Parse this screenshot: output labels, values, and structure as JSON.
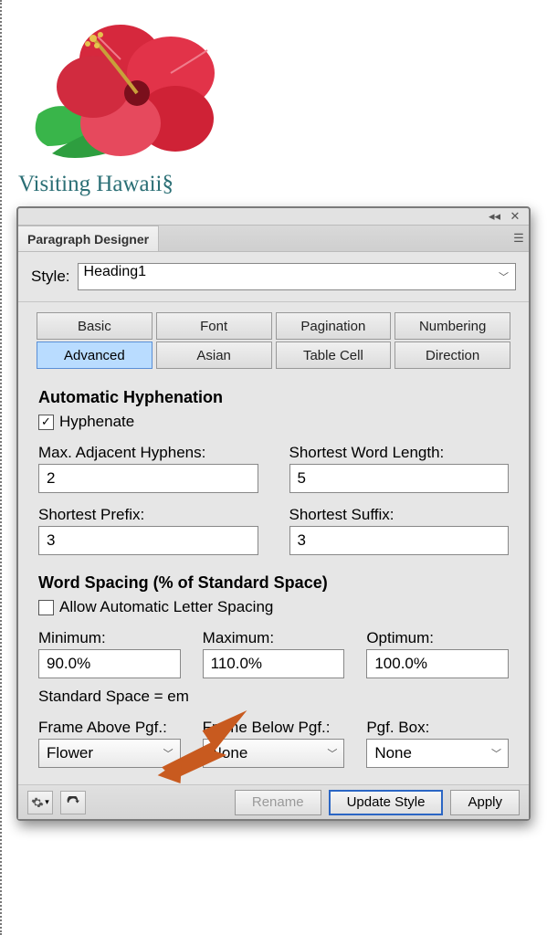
{
  "doc": {
    "heading": "Visiting Hawaii",
    "pilcrow": "§"
  },
  "panel": {
    "title": "Paragraph Designer",
    "style_label": "Style:",
    "style_value": "Heading1",
    "tabs1": {
      "basic": "Basic",
      "font": "Font",
      "pagination": "Pagination",
      "numbering": "Numbering"
    },
    "tabs2": {
      "advanced": "Advanced",
      "asian": "Asian",
      "tablecell": "Table Cell",
      "direction": "Direction"
    }
  },
  "hyph": {
    "title": "Automatic Hyphenation",
    "hyphenate": "Hyphenate",
    "max_adj_label": "Max. Adjacent Hyphens:",
    "max_adj_value": "2",
    "short_word_label": "Shortest Word Length:",
    "short_word_value": "5",
    "prefix_label": "Shortest Prefix:",
    "prefix_value": "3",
    "suffix_label": "Shortest Suffix:",
    "suffix_value": "3"
  },
  "ws": {
    "title": "Word Spacing (% of Standard Space)",
    "allow": "Allow Automatic Letter Spacing",
    "min_label": "Minimum:",
    "min_value": "90.0%",
    "max_label": "Maximum:",
    "max_value": "110.0%",
    "opt_label": "Optimum:",
    "opt_value": "100.0%",
    "std": "Standard Space =       em"
  },
  "frames": {
    "above_label": "Frame Above Pgf.:",
    "above_value": "Flower",
    "below_label": "Frame Below Pgf.:",
    "below_value": "None",
    "box_label": "Pgf. Box:",
    "box_value": "None"
  },
  "footer": {
    "rename": "Rename",
    "update": "Update Style",
    "apply": "Apply"
  }
}
